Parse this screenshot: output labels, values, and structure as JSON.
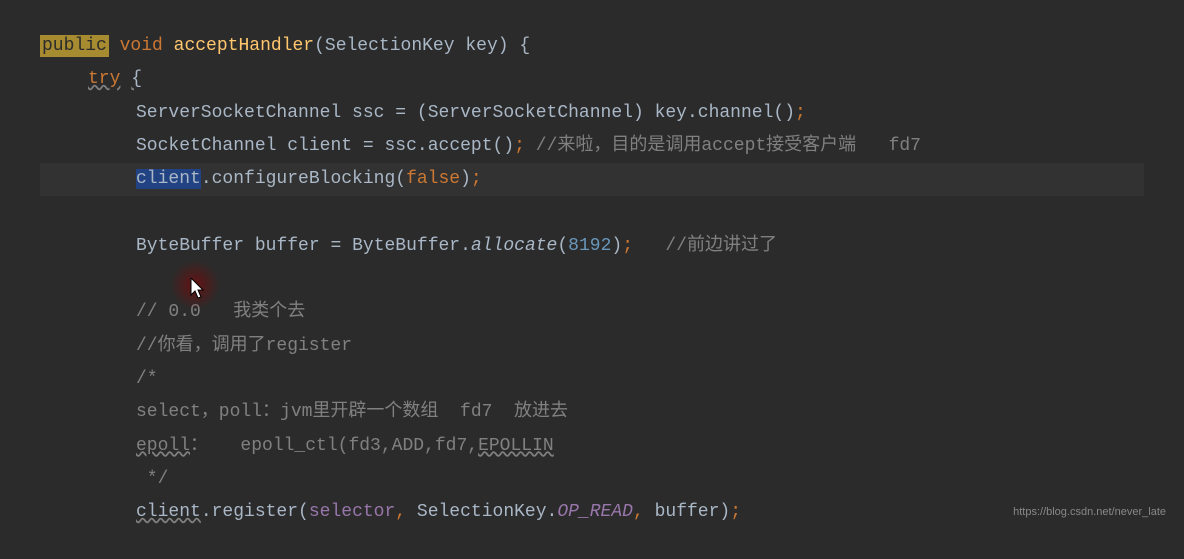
{
  "code": {
    "line1": {
      "public": "public",
      "void": "void",
      "method": "acceptHandler",
      "paramType": "SelectionKey",
      "paramName": "key"
    },
    "line2": {
      "try": "try"
    },
    "line3": {
      "type1": "ServerSocketChannel",
      "var1": "ssc",
      "cast": "ServerSocketChannel",
      "obj": "key",
      "method": "channel"
    },
    "line4": {
      "type1": "SocketChannel",
      "var1": "client",
      "obj": "ssc",
      "method": "accept",
      "comment": "//来啦，目的是调用accept接受客户端   fd7"
    },
    "line5": {
      "obj": "client",
      "method": "configureBlocking",
      "arg": "false"
    },
    "line7": {
      "type1": "ByteBuffer",
      "var1": "buffer",
      "type2": "ByteBuffer",
      "method": "allocate",
      "arg": "8192",
      "comment": "//前边讲过了"
    },
    "line9": {
      "comment": "// 0.0   我类个去"
    },
    "line10": {
      "comment": "//你看，调用了register"
    },
    "line11": {
      "comment": "/*"
    },
    "line12": {
      "comment": "select，poll：jvm里开辟一个数组  fd7  放进去"
    },
    "line13_a": "epoll",
    "line13_b": "：   epoll_ctl(fd3,ADD,fd7,",
    "line13_c": "EPOLLIN",
    "line14": {
      "comment": " */"
    },
    "line15": {
      "obj": "client",
      "method": "register",
      "arg1": "selector",
      "arg2type": "SelectionKey",
      "arg2field": "OP_READ",
      "arg3": "buffer"
    }
  },
  "watermark": "https://blog.csdn.net/never_late"
}
